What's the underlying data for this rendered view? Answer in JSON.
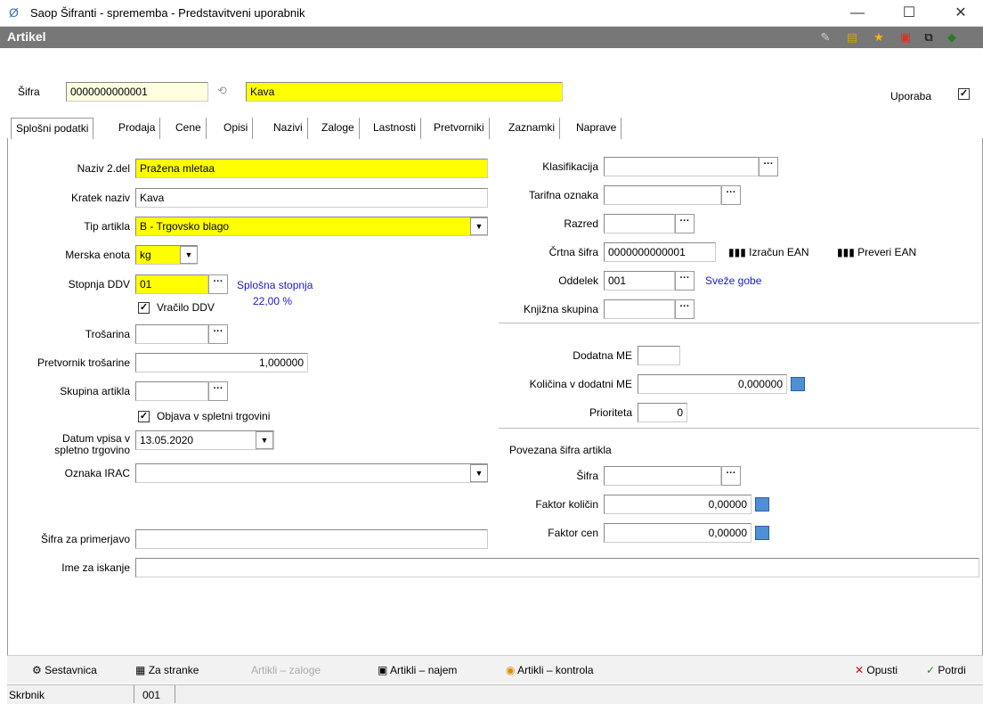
{
  "window": {
    "title": "Saop Šifranti - sprememba - Predstavitveni uporabnik",
    "minimize": "—",
    "maximize": "☐",
    "close": "✕"
  },
  "header": {
    "title": "Artikel"
  },
  "top": {
    "sifra_label": "Šifra",
    "sifra_value": "0000000000001",
    "naziv_value": "Kava",
    "uporaba_label": "Uporaba",
    "uporaba_checked": "✓"
  },
  "tabs": [
    "Splošni podatki",
    "Prodaja",
    "Cene",
    "Opisi",
    "Nazivi",
    "Zaloge",
    "Lastnosti",
    "Pretvorniki",
    "Zaznamki",
    "Naprave"
  ],
  "left": {
    "naziv2_label": "Naziv 2.del",
    "naziv2_value": "Pražena mletaa",
    "kratek_label": "Kratek naziv",
    "kratek_value": "Kava",
    "tip_label": "Tip artikla",
    "tip_value": "B - Trgovsko blago",
    "merska_label": "Merska enota",
    "merska_value": "kg",
    "ddv_label": "Stopnja DDV",
    "ddv_value": "01",
    "ddv_desc1": "Splošna stopnja",
    "ddv_desc2": "22,00 %",
    "vracilo_label": "Vračilo DDV",
    "trosarina_label": "Trošarina",
    "pretvornik_label": "Pretvornik trošarine",
    "pretvornik_value": "1,000000",
    "skupina_label": "Skupina artikla",
    "objava_label": "Objava v spletni trgovini",
    "datum_label1": "Datum vpisa  v",
    "datum_label2": "spletno trgovino",
    "datum_value": "13.05.2020",
    "irac_label": "Oznaka IRAC",
    "primerjava_label": "Šifra za primerjavo",
    "iskanje_label": "Ime za iskanje"
  },
  "right": {
    "klasifikacija_label": "Klasifikacija",
    "tarifna_label": "Tarifna oznaka",
    "razred_label": "Razred",
    "crtna_label": "Črtna šifra",
    "crtna_value": "0000000000001",
    "izracun_ean": "Izračun EAN",
    "preveri_ean": "Preveri EAN",
    "oddelek_label": "Oddelek",
    "oddelek_value": "001",
    "oddelek_desc": "Sveže gobe",
    "knjizna_label": "Knjižna skupina",
    "dodatna_label": "Dodatna ME",
    "kolicina_label": "Količina v dodatni ME",
    "kolicina_value": "0,000000",
    "prioriteta_label": "Prioriteta",
    "prioriteta_value": "0",
    "povezana_label": "Povezana šifra artikla",
    "pov_sifra_label": "Šifra",
    "faktor_kol_label": "Faktor količin",
    "faktor_kol_value": "0,00000",
    "faktor_cen_label": "Faktor cen",
    "faktor_cen_value": "0,00000"
  },
  "toolbar": {
    "sestavnica": "Sestavnica",
    "za_stranke": "Za stranke",
    "artikli_zaloge": "Artikli – zaloge",
    "artikli_najem": "Artikli – najem",
    "artikli_kontrola": "Artikli – kontrola",
    "opusti": "Opusti",
    "potrdi": "Potrdi"
  },
  "status": {
    "label": "Skrbnik",
    "value": "001"
  },
  "colors": {
    "highlight": "#ffff00",
    "header": "#777777",
    "link_blue": "#1a1acc"
  }
}
